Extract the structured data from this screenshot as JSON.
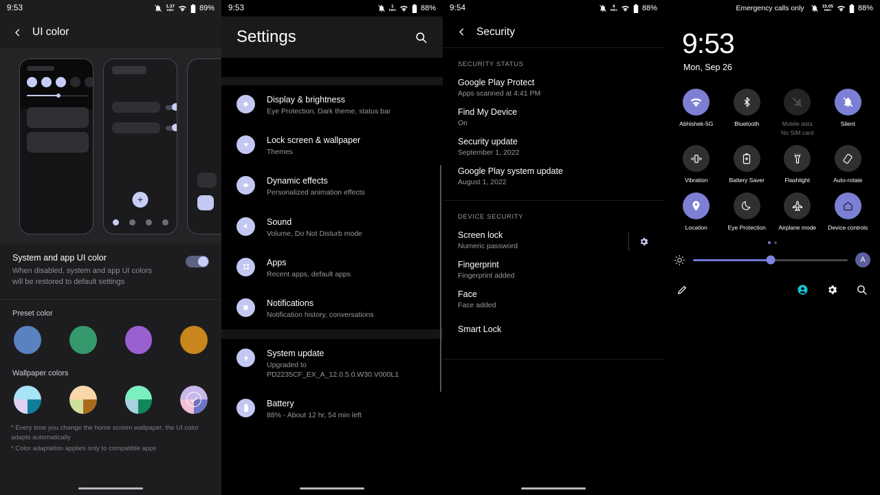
{
  "panel1": {
    "statusbar": {
      "time": "9:53",
      "net_value": "1.37",
      "net_unit": "KB/s",
      "battery": "89%",
      "icons": [
        "bell-muted-icon",
        "network-speed-icon",
        "wifi-icon",
        "battery-icon"
      ]
    },
    "header": {
      "back_icon": "back-arrow-icon",
      "title": "UI color"
    },
    "preview": {
      "phone_count": 3,
      "fab_label": "+"
    },
    "row": {
      "title": "System and app UI color",
      "subtitle": "When disabled, system and app UI colors will be restored to default settings",
      "toggle_state": "on"
    },
    "preset_label": "Preset color",
    "preset_colors": [
      "#5b82c0",
      "#36996b",
      "#9a5fd0",
      "#c9861b"
    ],
    "wallpaper_label": "Wallpaper colors",
    "wallpaper_swatches": [
      {
        "top": "#a8e4f7",
        "bl": "#e0d2f2",
        "br": "#107f9b",
        "selected": false
      },
      {
        "top": "#f9d7a8",
        "bl": "#cfe09a",
        "br": "#a96a1c",
        "selected": false
      },
      {
        "top": "#7aefc0",
        "bl": "#a8d2dd",
        "br": "#12875c",
        "selected": false
      },
      {
        "top": "#c8b8ea",
        "bl": "#f3bfd4",
        "br": "#6f74c4",
        "selected": true
      }
    ],
    "footnote_1": "* Every time you change the home screen wallpaper, the UI color adapts automatically",
    "footnote_2": "* Color adaptation applies only to compatible apps"
  },
  "panel2": {
    "statusbar": {
      "time": "9:53",
      "net_value": "1",
      "net_unit": "KB/s",
      "battery": "88%"
    },
    "header": {
      "title": "Settings",
      "search_icon": "search-icon"
    },
    "group1": [
      {
        "icon": "display-icon",
        "title": "Display & brightness",
        "subtitle": "Eye Protection, Dark theme, status bar"
      },
      {
        "icon": "lockscreen-icon",
        "title": "Lock screen & wallpaper",
        "subtitle": "Themes"
      },
      {
        "icon": "dynamic-effects-icon",
        "title": "Dynamic effects",
        "subtitle": "Personalized animation effects"
      },
      {
        "icon": "sound-icon",
        "title": "Sound",
        "subtitle": "Volume, Do Not Disturb mode"
      },
      {
        "icon": "apps-icon",
        "title": "Apps",
        "subtitle": "Recent apps, default apps"
      },
      {
        "icon": "notifications-icon",
        "title": "Notifications",
        "subtitle": "Notification history, conversations"
      }
    ],
    "group2": [
      {
        "icon": "system-update-icon",
        "title": "System update",
        "subtitle": "Upgraded to\nPD2235CF_EX_A_12.0.5.0.W30.V000L1"
      },
      {
        "icon": "battery-icon",
        "title": "Battery",
        "subtitle": "88% - About 12 hr, 54 min left"
      }
    ]
  },
  "panel3": {
    "statusbar": {
      "time": "9:54",
      "net_value": "4",
      "net_unit": "KB/s",
      "battery": "88%"
    },
    "header": {
      "back_icon": "back-arrow-icon",
      "title": "Security"
    },
    "section1_label": "SECURITY STATUS",
    "section1": [
      {
        "title": "Google Play Protect",
        "subtitle": "Apps scanned at 4:41 PM"
      },
      {
        "title": "Find My Device",
        "subtitle": "On"
      },
      {
        "title": "Security update",
        "subtitle": "September 1, 2022"
      },
      {
        "title": "Google Play system update",
        "subtitle": "August 1, 2022"
      }
    ],
    "section2_label": "DEVICE SECURITY",
    "section2": [
      {
        "title": "Screen lock",
        "subtitle": "Numeric password",
        "gear": "gear-icon"
      },
      {
        "title": "Fingerprint",
        "subtitle": "Fingerprint added",
        "gear": ""
      },
      {
        "title": "Face",
        "subtitle": "Face added",
        "gear": ""
      },
      {
        "title": "Smart Lock",
        "subtitle": "",
        "gear": ""
      }
    ]
  },
  "panel4": {
    "statusbar": {
      "carrier": "Emergency calls only",
      "net_value": "15.05",
      "net_unit": "KB/s",
      "battery": "88%"
    },
    "clock": "9:53",
    "date": "Mon, Sep 26",
    "tiles": [
      {
        "icon": "wifi-icon",
        "label": "Abhishek-5G",
        "sublabel": "",
        "state": "on"
      },
      {
        "icon": "bluetooth-icon",
        "label": "Bluetooth",
        "sublabel": "",
        "state": "off"
      },
      {
        "icon": "mobile-data-off-icon",
        "label": "Mobile data",
        "sublabel": "No SIM card",
        "state": "disabled"
      },
      {
        "icon": "bell-muted-icon",
        "label": "Silent",
        "sublabel": "",
        "state": "on"
      },
      {
        "icon": "vibration-icon",
        "label": "Vibration",
        "sublabel": "",
        "state": "off"
      },
      {
        "icon": "battery-saver-icon",
        "label": "Battery Saver",
        "sublabel": "",
        "state": "off"
      },
      {
        "icon": "flashlight-icon",
        "label": "Flashlight",
        "sublabel": "",
        "state": "off"
      },
      {
        "icon": "auto-rotate-icon",
        "label": "Auto-rotate",
        "sublabel": "",
        "state": "off"
      },
      {
        "icon": "location-icon",
        "label": "Location",
        "sublabel": "",
        "state": "on"
      },
      {
        "icon": "eye-protection-icon",
        "label": "Eye Protection",
        "sublabel": "",
        "state": "off"
      },
      {
        "icon": "airplane-icon",
        "label": "Airplane mode",
        "sublabel": "",
        "state": "off"
      },
      {
        "icon": "device-controls-icon",
        "label": "Device controls",
        "sublabel": "",
        "state": "on"
      }
    ],
    "pages": {
      "count": 2,
      "active": 1
    },
    "brightness": {
      "icon": "brightness-icon",
      "percent": 50,
      "auto_label": "A"
    },
    "bottom_icons": [
      "edit-pencil-icon",
      "user-account-icon",
      "settings-gear-icon",
      "search-icon"
    ],
    "accent": "#7c7fd4"
  }
}
